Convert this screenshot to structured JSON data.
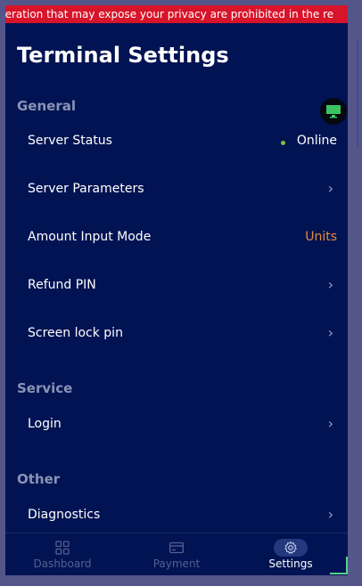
{
  "banner": {
    "text": "peration that may expose your privacy are prohibited in the re"
  },
  "header": {
    "title": "Terminal Settings"
  },
  "sections": {
    "general": "General",
    "service": "Service",
    "other": "Other"
  },
  "rows": {
    "server_status": {
      "label": "Server Status",
      "value": "Online"
    },
    "server_parameters": {
      "label": "Server Parameters"
    },
    "amount_input_mode": {
      "label": "Amount Input Mode",
      "value": "Units"
    },
    "refund_pin": {
      "label": "Refund PIN"
    },
    "screen_lock_pin": {
      "label": "Screen lock pin"
    },
    "login": {
      "label": "Login"
    },
    "diagnostics": {
      "label": "Diagnostics"
    }
  },
  "chevron": "›",
  "nav": {
    "dashboard": "Dashboard",
    "payment": "Payment",
    "settings": "Settings"
  },
  "colors": {
    "background": "#021353",
    "banner": "#d8142a",
    "accent_orange": "#e08a3c",
    "status_green": "#7ec13a"
  },
  "icons": {
    "monitor": "monitor-icon",
    "dashboard": "grid-icon",
    "payment": "card-icon",
    "settings": "gear-icon"
  }
}
